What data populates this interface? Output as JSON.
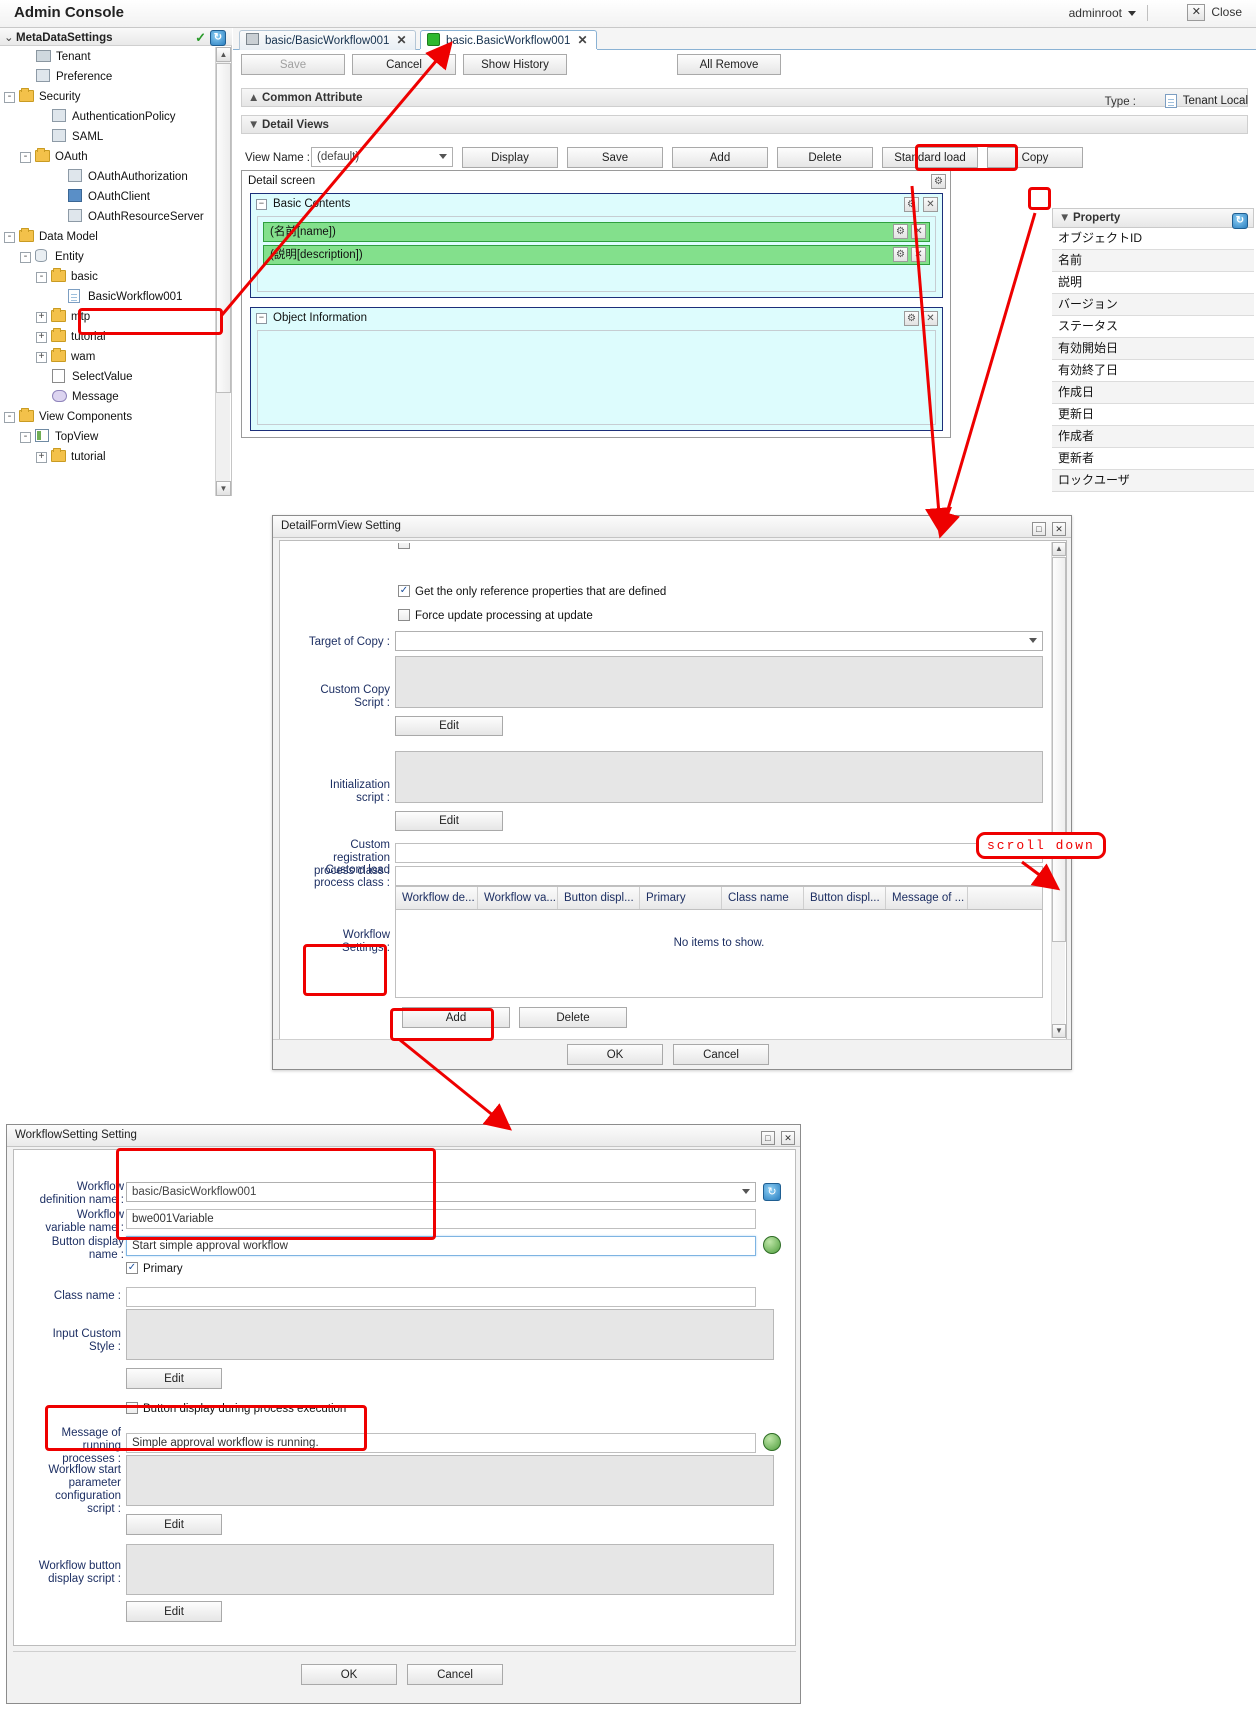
{
  "app": {
    "title": "Admin Console",
    "user": "adminroot",
    "close_label": "Close"
  },
  "tree_panel": {
    "header": "MetaDataSettings",
    "nodes": [
      {
        "label": "Tenant",
        "depth": 1,
        "expander": "",
        "icon": "home-icon"
      },
      {
        "label": "Preference",
        "depth": 1,
        "expander": "",
        "icon": "preference-icon"
      },
      {
        "label": "Security",
        "depth": 0,
        "expander": "-",
        "icon": "folder-icon"
      },
      {
        "label": "AuthenticationPolicy",
        "depth": 2,
        "expander": "",
        "icon": "policy-icon"
      },
      {
        "label": "SAML",
        "depth": 2,
        "expander": "",
        "icon": "saml-icon"
      },
      {
        "label": "OAuth",
        "depth": 1,
        "expander": "-",
        "icon": "folder-icon"
      },
      {
        "label": "OAuthAuthorization",
        "depth": 3,
        "expander": "",
        "icon": "oauth-icon"
      },
      {
        "label": "OAuthClient",
        "depth": 3,
        "expander": "",
        "icon": "oauth-client-icon"
      },
      {
        "label": "OAuthResourceServer",
        "depth": 3,
        "expander": "",
        "icon": "oauth-resource-icon"
      },
      {
        "label": "Data Model",
        "depth": 0,
        "expander": "-",
        "icon": "folder-icon"
      },
      {
        "label": "Entity",
        "depth": 1,
        "expander": "-",
        "icon": "entity-icon"
      },
      {
        "label": "basic",
        "depth": 2,
        "expander": "-",
        "icon": "folder-icon"
      },
      {
        "label": "BasicWorkflow001",
        "depth": 3,
        "expander": "",
        "icon": "document-icon"
      },
      {
        "label": "mtp",
        "depth": 2,
        "expander": "+",
        "icon": "folder-icon"
      },
      {
        "label": "tutorial",
        "depth": 2,
        "expander": "+",
        "icon": "folder-icon"
      },
      {
        "label": "wam",
        "depth": 2,
        "expander": "+",
        "icon": "folder-icon"
      },
      {
        "label": "SelectValue",
        "depth": 2,
        "expander": "",
        "icon": "selectvalue-icon"
      },
      {
        "label": "Message",
        "depth": 2,
        "expander": "",
        "icon": "message-icon"
      },
      {
        "label": "View Components",
        "depth": 0,
        "expander": "-",
        "icon": "folder-icon"
      },
      {
        "label": "TopView",
        "depth": 1,
        "expander": "-",
        "icon": "topview-icon"
      },
      {
        "label": "tutorial",
        "depth": 2,
        "expander": "+",
        "icon": "folder-icon"
      }
    ]
  },
  "editor": {
    "tabs": [
      {
        "label": "basic/BasicWorkflow001",
        "icon": "network-icon",
        "active": false
      },
      {
        "label": "basic.BasicWorkflow001",
        "icon": "cube-icon",
        "active": true
      }
    ],
    "toolbar": {
      "save": "Save",
      "cancel": "Cancel",
      "show_history": "Show History",
      "all_remove": "All Remove"
    },
    "sections": {
      "common_attribute": "Common Attribute",
      "detail_views": "Detail Views"
    },
    "type_label": "Type :",
    "type_value": "Tenant Local",
    "view_name_label": "View Name :",
    "view_name_value": "(default)",
    "view_buttons": [
      "Display",
      "Save",
      "Add",
      "Delete",
      "Standard load",
      "Copy"
    ],
    "detail_screen": {
      "title": "Detail screen",
      "basic_contents": {
        "title": "Basic Contents",
        "fields": [
          "(名前[name])",
          "(説明[description])"
        ]
      },
      "object_information": {
        "title": "Object Information"
      }
    }
  },
  "property_panel": {
    "title": "Property",
    "rows": [
      "オブジェクトID",
      "名前",
      "説明",
      "バージョン",
      "ステータス",
      "有効開始日",
      "有効終了日",
      "作成日",
      "更新日",
      "作成者",
      "更新者",
      "ロックユーザ"
    ]
  },
  "detail_form_view_dialog": {
    "title": "DetailFormView Setting",
    "checkboxes": [
      {
        "label": "Get the only reference properties that are defined",
        "checked": true
      },
      {
        "label": "Force update processing at update",
        "checked": false
      }
    ],
    "fields": {
      "target_of_copy": {
        "label": "Target of Copy :",
        "value": ""
      },
      "custom_copy_script": {
        "label": "Custom Copy\nScript :",
        "value": ""
      },
      "initialization_script": {
        "label": "Initialization\nscript :",
        "value": ""
      },
      "custom_registration_process_class": {
        "label": "Custom\nregistration\nprocess class :",
        "value": ""
      },
      "custom_load_process_class": {
        "label": "Custom load\nprocess class :",
        "value": ""
      },
      "workflow_settings": {
        "label": "Workflow\nSettings :"
      }
    },
    "edit_label": "Edit",
    "table": {
      "columns": [
        "Workflow de...",
        "Workflow va...",
        "Button displ...",
        "Primary",
        "Class name",
        "Button displ...",
        "Message of ..."
      ],
      "empty_text": "No items to show."
    },
    "table_buttons": {
      "add": "Add",
      "delete": "Delete"
    },
    "footer_buttons": {
      "ok": "OK",
      "cancel": "Cancel"
    }
  },
  "workflow_setting_dialog": {
    "title": "WorkflowSetting Setting",
    "fields": {
      "workflow_definition_name": {
        "label": "Workflow\ndefinition name :",
        "value": "basic/BasicWorkflow001"
      },
      "workflow_variable_name": {
        "label": "Workflow\nvariable name :",
        "value": "bwe001Variable"
      },
      "button_display_name": {
        "label": "Button display\nname :",
        "value": "Start simple approval workflow"
      },
      "class_name": {
        "label": "Class name :",
        "value": ""
      },
      "input_custom_style": {
        "label": "Input Custom\nStyle :",
        "value": ""
      },
      "message_of_running_processes": {
        "label": "Message of\nrunning\nprocesses :",
        "value": "Simple approval workflow is running."
      },
      "workflow_start_parameter_configuration_script": {
        "label": "Workflow start\nparameter\nconfiguration\nscript :",
        "value": ""
      },
      "workflow_button_display_script": {
        "label": "Workflow button\ndisplay script :",
        "value": ""
      }
    },
    "checkboxes": [
      {
        "label": "Primary",
        "checked": true
      },
      {
        "label": "Button display during process execution",
        "checked": false
      }
    ],
    "edit_label": "Edit",
    "footer_buttons": {
      "ok": "OK",
      "cancel": "Cancel"
    }
  },
  "annotations": {
    "scroll_down": "scroll down",
    "accent_color": "#ee0000"
  }
}
